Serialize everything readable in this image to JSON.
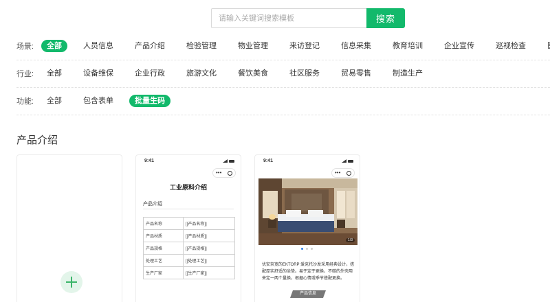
{
  "search": {
    "placeholder": "请输入关键词搜索模板",
    "button_label": "搜索"
  },
  "filters": {
    "scene": {
      "label": "场景:",
      "options": [
        "全部",
        "人员信息",
        "产品介绍",
        "检验管理",
        "物业管理",
        "来访登记",
        "信息采集",
        "教育培训",
        "企业宣传",
        "巡视检查",
        "医疗健康"
      ],
      "active": 0
    },
    "industry": {
      "label": "行业:",
      "options": [
        "全部",
        "设备维保",
        "企业行政",
        "旅游文化",
        "餐饮美食",
        "社区服务",
        "贸易零售",
        "制造生产"
      ],
      "active": -1
    },
    "function": {
      "label": "功能:",
      "options": [
        "全部",
        "包含表单",
        "批量生码"
      ],
      "active": 2
    }
  },
  "section": {
    "title": "产品介绍"
  },
  "cards": [
    {
      "type": "add",
      "icon": "plus-icon"
    },
    {
      "type": "template",
      "time": "9:41",
      "title": "工业原料介绍",
      "subtitle": "产品介绍",
      "rows": [
        [
          "产品名称",
          "[[产品名称]]"
        ],
        [
          "产品材质",
          "[[产品材质]]"
        ],
        [
          "产品规格",
          "[[产品规格]]"
        ],
        [
          "处理工艺",
          "[[处理工艺]]"
        ],
        [
          "生产厂家",
          "[[生产厂家]]"
        ]
      ]
    },
    {
      "type": "template",
      "time": "9:41",
      "photo_counter": "1/3",
      "description": "优安奈宽的EKTORP 爱克托沙发采用经典设计，搭配厚实舒适的坐垫。易于定于更换，不碳的外壳用来定一两个量换，根据心情或季节搭配更换。",
      "tag": "产品信息"
    }
  ],
  "colors": {
    "accent": "#12b96b",
    "add_bg": "#e3f5ea"
  }
}
